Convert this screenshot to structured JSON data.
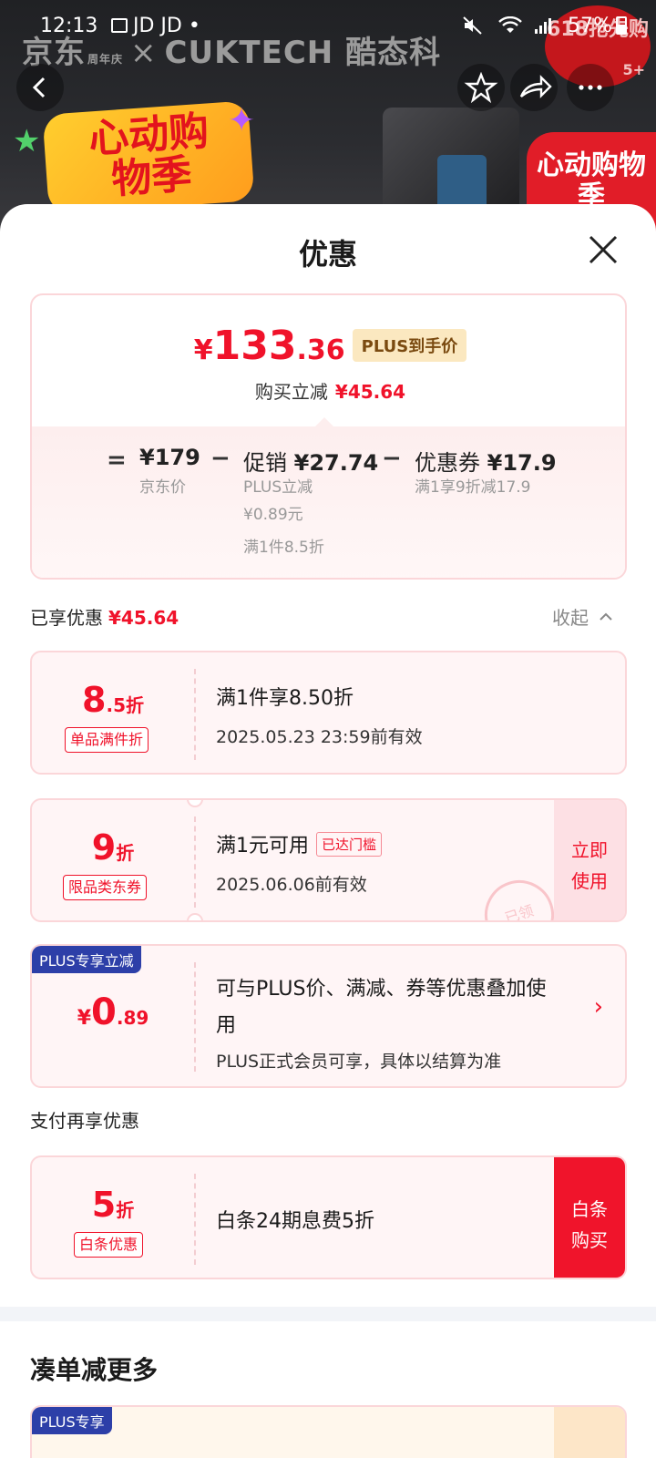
{
  "status_bar": {
    "time": "12:13",
    "app_label": "JD JD",
    "dot": "•",
    "battery": "57%"
  },
  "background": {
    "brand_left": "京东",
    "brand_small": "周年庆",
    "brand_x": "×",
    "brand_right": "CUKTECH",
    "brand_cn": "酷态科",
    "promo_title": "心动购物季",
    "right_banner": "心动购物季",
    "badge_text": "618抢先购",
    "badge_count": "5+"
  },
  "sheet": {
    "title": "优惠"
  },
  "summary": {
    "currency": "¥",
    "price_int": "133",
    "price_dec": ".36",
    "plus_tag": "PLUS到手价",
    "reduce_label": "购买立减",
    "reduce_value": "¥45.64",
    "eq": "=",
    "minus": "−",
    "jd_price": "¥179",
    "jd_price_label": "京东价",
    "promo_label": "促销",
    "promo_value": "¥27.74",
    "promo_sub1": "PLUS立减",
    "promo_sub2": "¥0.89元",
    "promo_sub3": "满1件8.5折",
    "coupon_label": "优惠券",
    "coupon_value": "¥17.9",
    "coupon_sub": "满1享9折减17.9"
  },
  "enjoyed": {
    "label": "已享优惠",
    "value": "¥45.64",
    "collapse": "收起"
  },
  "coupons": [
    {
      "big": "8",
      "small": ".5折",
      "tag": "单品满件折",
      "main": "满1件享8.50折",
      "date": "2025.05.23 23:59前有效"
    },
    {
      "big": "9",
      "small": "折",
      "tag": "限品类东券",
      "main": "满1元可用",
      "reach": "已达门槛",
      "date": "2025.06.06前有效",
      "action_line1": "立即",
      "action_line2": "使用",
      "stamp": "已领"
    }
  ],
  "plus_card": {
    "corner": "PLUS专享立减",
    "currency": "¥",
    "int": "0",
    "dec": ".89",
    "main": "可与PLUS价、满减、券等优惠叠加使用",
    "sub": "PLUS正式会员可享，具体以结算为准",
    "chevron": "›"
  },
  "pay_section": {
    "label": "支付再享优惠",
    "big": "5",
    "small": "折",
    "tag": "白条优惠",
    "main": "白条24期息费5折",
    "action_line1": "白条",
    "action_line2": "购买"
  },
  "more": {
    "title": "凑单减更多",
    "peek_corner": "PLUS专享"
  },
  "colors": {
    "accent_red": "#f0122a",
    "plus_blue": "#2d3fa8",
    "plus_gold": "#fbe8c0"
  }
}
